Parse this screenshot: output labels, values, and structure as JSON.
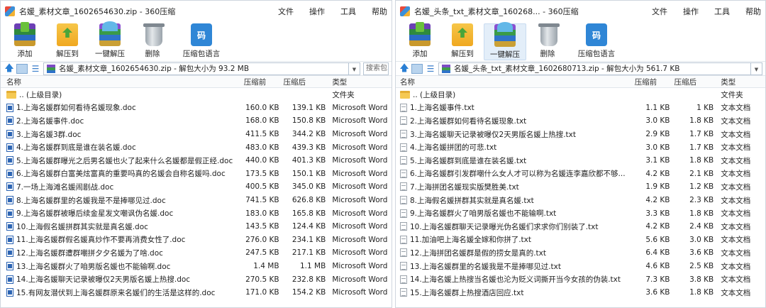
{
  "windows": [
    {
      "title": "名媛_素材文章_1602654630.zip - 360压缩",
      "menus": [
        "文件",
        "操作",
        "工具",
        "帮助"
      ],
      "toolbar": [
        {
          "label": "添加",
          "icon": "add-archive-icon"
        },
        {
          "label": "解压到",
          "icon": "extract-to-icon"
        },
        {
          "label": "一键解压",
          "icon": "one-click-extract-icon"
        },
        {
          "label": "删除",
          "icon": "trash-bin-icon"
        },
        {
          "label": "压缩包语言",
          "icon": "archive-language-icon",
          "glyph": "码"
        }
      ],
      "address": "名媛_素材文章_1602654630.zip - 解包大小为 93.2 MB",
      "search_placeholder": "搜索包",
      "columns": {
        "name": "名称",
        "compressed": "压缩前",
        "original": "压缩后",
        "type": "类型"
      },
      "files": [
        {
          "icon": "folder",
          "name": ".. (上级目录)",
          "compressed": "",
          "original": "",
          "type": "文件夹"
        },
        {
          "icon": "doc",
          "name": "1.上海名媛群如何看待名媛现象.doc",
          "compressed": "160.0 KB",
          "original": "139.1 KB",
          "type": "Microsoft Word"
        },
        {
          "icon": "doc",
          "name": "2.上海名媛事件.doc",
          "compressed": "168.0 KB",
          "original": "150.8 KB",
          "type": "Microsoft Word"
        },
        {
          "icon": "doc",
          "name": "3.上海名媛3群.doc",
          "compressed": "411.5 KB",
          "original": "344.2 KB",
          "type": "Microsoft Word"
        },
        {
          "icon": "doc",
          "name": "4.上海名媛群到底是谁在装名媛.doc",
          "compressed": "483.0 KB",
          "original": "439.3 KB",
          "type": "Microsoft Word"
        },
        {
          "icon": "doc",
          "name": "5.上海名媛群曝光之后男名媛也火了起来什么名媛都是假正经.doc",
          "compressed": "440.0 KB",
          "original": "401.3 KB",
          "type": "Microsoft Word"
        },
        {
          "icon": "doc",
          "name": "6.上海名媛群白富美炫富真的重要吗真的名媛会自称名媛吗.doc",
          "compressed": "173.5 KB",
          "original": "150.1 KB",
          "type": "Microsoft Word"
        },
        {
          "icon": "doc",
          "name": "7.一场上海滩名媛闹剧战.doc",
          "compressed": "400.5 KB",
          "original": "345.0 KB",
          "type": "Microsoft Word"
        },
        {
          "icon": "doc",
          "name": "8.上海名媛群里的名媛我是不是捧哪见过.doc",
          "compressed": "741.5 KB",
          "original": "626.8 KB",
          "type": "Microsoft Word"
        },
        {
          "icon": "doc",
          "name": "9.上海名媛群被曝后续金星发文嘲讽伪名媛.doc",
          "compressed": "183.0 KB",
          "original": "165.8 KB",
          "type": "Microsoft Word"
        },
        {
          "icon": "doc",
          "name": "10.上海假名媛拼群其实就是真名媛.doc",
          "compressed": "143.5 KB",
          "original": "124.4 KB",
          "type": "Microsoft Word"
        },
        {
          "icon": "doc",
          "name": "11.上海名媛群假名媛真炒作不要再消费女性了.doc",
          "compressed": "276.0 KB",
          "original": "234.1 KB",
          "type": "Microsoft Word"
        },
        {
          "icon": "doc",
          "name": "12.上海名媛群遭群嘲拼夕夕名媛为了啥.doc",
          "compressed": "247.5 KB",
          "original": "217.1 KB",
          "type": "Microsoft Word"
        },
        {
          "icon": "doc",
          "name": "13.上海名媛群火了咱男版名媛也不能输啊.doc",
          "compressed": "1.4 MB",
          "original": "1.1 MB",
          "type": "Microsoft Word"
        },
        {
          "icon": "doc",
          "name": "14.上海名媛聊天记录被曝仅2天男版名媛上热搜.doc",
          "compressed": "270.5 KB",
          "original": "232.8 KB",
          "type": "Microsoft Word"
        },
        {
          "icon": "doc",
          "name": "15.有网友潜伏到上海名媛群原来名媛们的生活是这样的.doc",
          "compressed": "171.0 KB",
          "original": "154.2 KB",
          "type": "Microsoft Word"
        }
      ]
    },
    {
      "title": "名媛_头条_txt_素材文章_160268... - 360压缩",
      "menus": [
        "文件",
        "操作",
        "工具",
        "帮助"
      ],
      "toolbar": [
        {
          "label": "添加",
          "icon": "add-archive-icon"
        },
        {
          "label": "解压到",
          "icon": "extract-to-icon"
        },
        {
          "label": "一键解压",
          "icon": "one-click-extract-icon"
        },
        {
          "label": "删除",
          "icon": "trash-bin-icon"
        },
        {
          "label": "压缩包语言",
          "icon": "archive-language-icon",
          "glyph": "码"
        }
      ],
      "address": "名媛_头条_txt_素材文章_1602680713.zip - 解包大小为 561.7 KB",
      "columns": {
        "name": "名称",
        "compressed": "压缩前",
        "original": "压缩后",
        "type": "类型"
      },
      "files": [
        {
          "icon": "folder",
          "name": ".. (上级目录)",
          "compressed": "",
          "original": "",
          "type": "文件夹"
        },
        {
          "icon": "txt",
          "name": "1.上海名媛事件.txt",
          "compressed": "1.1 KB",
          "original": "1 KB",
          "type": "文本文档"
        },
        {
          "icon": "txt",
          "name": "2.上海名媛群如何看待名媛现象.txt",
          "compressed": "3.0 KB",
          "original": "1.8 KB",
          "type": "文本文档"
        },
        {
          "icon": "txt",
          "name": "3.上海名媛聊天记录被曝仅2天男版名媛上热搜.txt",
          "compressed": "2.9 KB",
          "original": "1.7 KB",
          "type": "文本文档"
        },
        {
          "icon": "txt",
          "name": "4.上海名媛拼团的可悲.txt",
          "compressed": "3.0 KB",
          "original": "1.7 KB",
          "type": "文本文档"
        },
        {
          "icon": "txt",
          "name": "5.上海名媛群到底是谁在装名媛.txt",
          "compressed": "3.1 KB",
          "original": "1.8 KB",
          "type": "文本文档"
        },
        {
          "icon": "txt",
          "name": "6.上海名媛群引发群嘲什么女人才可以称为名媛连李嘉欣都不够...",
          "compressed": "4.2 KB",
          "original": "2.1 KB",
          "type": "文本文档"
        },
        {
          "icon": "txt",
          "name": "7.上海拼团名媛现实版樊胜美.txt",
          "compressed": "1.9 KB",
          "original": "1.2 KB",
          "type": "文本文档"
        },
        {
          "icon": "txt",
          "name": "8.上海假名媛拼群其实就是真名媛.txt",
          "compressed": "4.2 KB",
          "original": "2.3 KB",
          "type": "文本文档"
        },
        {
          "icon": "txt",
          "name": "9.上海名媛群火了咱男版名媛也不能输啊.txt",
          "compressed": "3.3 KB",
          "original": "1.8 KB",
          "type": "文本文档"
        },
        {
          "icon": "txt",
          "name": "10.上海名媛群聊天记录曝光伪名媛们求求你们别装了.txt",
          "compressed": "4.2 KB",
          "original": "2.4 KB",
          "type": "文本文档"
        },
        {
          "icon": "txt",
          "name": "11.加油吧上海名媛全嫁和你拼了.txt",
          "compressed": "5.6 KB",
          "original": "3.0 KB",
          "type": "文本文档"
        },
        {
          "icon": "txt",
          "name": "12.上海拼团名媛群是假的捞女是真的.txt",
          "compressed": "6.4 KB",
          "original": "3.6 KB",
          "type": "文本文档"
        },
        {
          "icon": "txt",
          "name": "13.上海名媛群里的名媛我是不是捧哪见过.txt",
          "compressed": "4.6 KB",
          "original": "2.5 KB",
          "type": "文本文档"
        },
        {
          "icon": "txt",
          "name": "14.上海名媛上热搜当名媛也沦为贬义词撕开当今女孩的伪装.txt",
          "compressed": "7.3 KB",
          "original": "3.8 KB",
          "type": "文本文档"
        },
        {
          "icon": "txt",
          "name": "15.上海名媛群上热搜酒店回应.txt",
          "compressed": "3.6 KB",
          "original": "1.8 KB",
          "type": "文本文档"
        }
      ]
    }
  ]
}
